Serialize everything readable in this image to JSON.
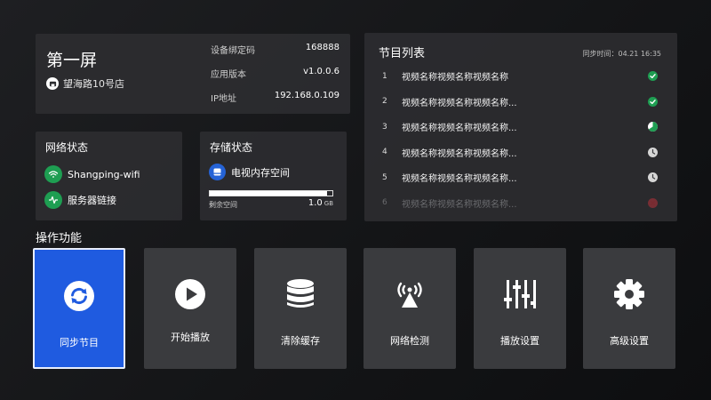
{
  "device": {
    "screen_title": "第一屏",
    "store_name": "望海路10号店",
    "info": [
      {
        "label": "设备绑定码",
        "value": "168888"
      },
      {
        "label": "应用版本",
        "value": "v1.0.0.6"
      },
      {
        "label": "IP地址",
        "value": "192.168.0.109"
      }
    ]
  },
  "network": {
    "title": "网络状态",
    "wifi_name": "Shangping-wifi",
    "server_label": "服务器链接"
  },
  "storage": {
    "title": "存储状态",
    "device_label": "电视内存空间",
    "remaining_label": "剩余空间",
    "remaining_value": "1.0",
    "remaining_unit": "GB",
    "used_fraction": 0.96
  },
  "programs": {
    "title": "节目列表",
    "sync_time": "同步时间：04.21 16:35",
    "items": [
      {
        "num": "1",
        "name": "视频名称视频名称视频名称",
        "status": "done"
      },
      {
        "num": "2",
        "name": "视频名称视频名称视频名称...",
        "status": "done"
      },
      {
        "num": "3",
        "name": "视频名称视频名称视频名称...",
        "status": "partial"
      },
      {
        "num": "4",
        "name": "视频名称视频名称视频名称...",
        "status": "pending"
      },
      {
        "num": "5",
        "name": "视频名称视频名称视频名称...",
        "status": "pending"
      },
      {
        "num": "6",
        "name": "视频名称视频名称视频名称...",
        "status": "error"
      }
    ]
  },
  "operations": {
    "title": "操作功能",
    "tiles": [
      {
        "label": "同步节目",
        "icon": "sync-icon"
      },
      {
        "label": "开始播放",
        "icon": "play-icon"
      },
      {
        "label": "清除缓存",
        "icon": "database-icon"
      },
      {
        "label": "网络检测",
        "icon": "antenna-icon"
      },
      {
        "label": "播放设置",
        "icon": "sliders-icon"
      },
      {
        "label": "高级设置",
        "icon": "gear-icon"
      }
    ]
  },
  "colors": {
    "accent_blue": "#1f5be0",
    "success_green": "#1e9e52",
    "error_red": "#b8323a"
  }
}
